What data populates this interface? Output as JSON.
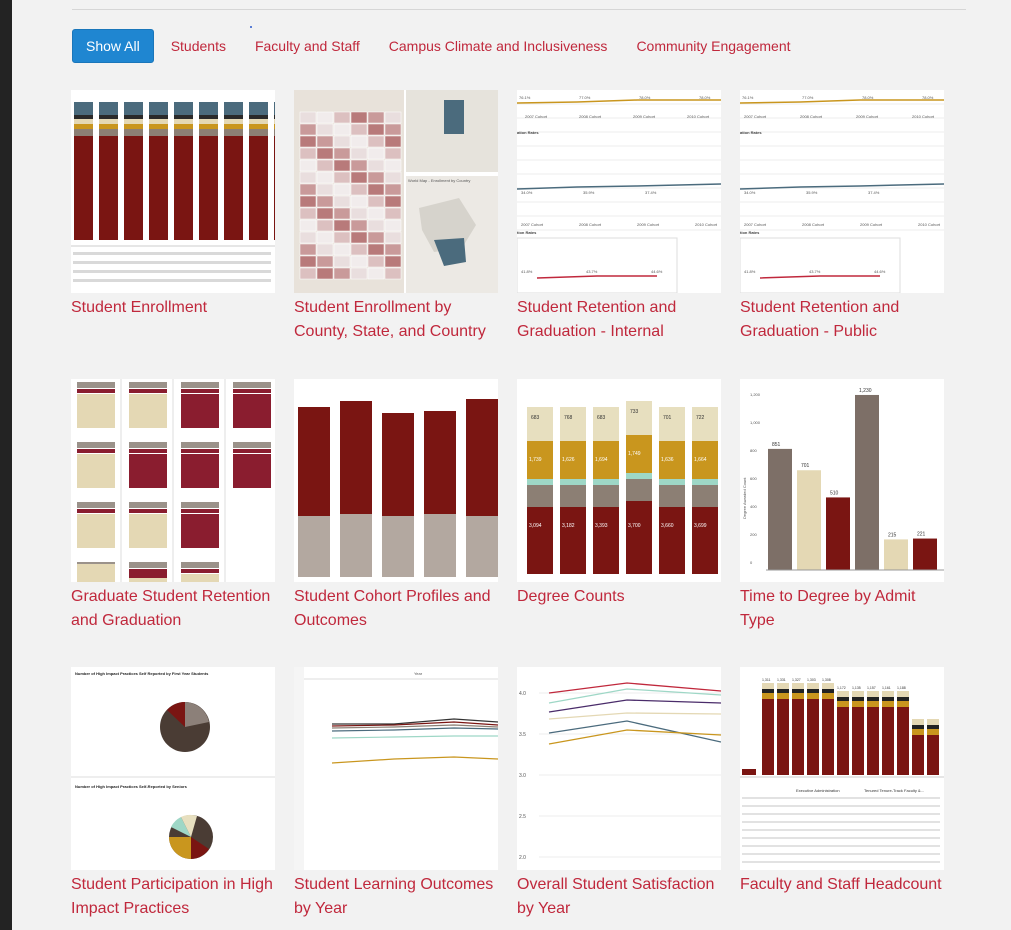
{
  "filters": {
    "show_all": "Show All",
    "students": "Students",
    "faculty_staff": "Faculty and Staff",
    "campus_climate": "Campus Climate and Inclusiveness",
    "community": "Community Engagement"
  },
  "tiles": [
    {
      "title": "Student Enrollment"
    },
    {
      "title": "Student Enrollment by County, State, and Country"
    },
    {
      "title": "Student Retention and Graduation - Internal"
    },
    {
      "title": "Student Retention and Graduation - Public"
    },
    {
      "title": "Graduate Student Retention and Graduation"
    },
    {
      "title": "Student Cohort Profiles and Outcomes"
    },
    {
      "title": "Degree Counts"
    },
    {
      "title": "Time to Degree by Admit Type"
    },
    {
      "title": "Student Participation in High Impact Practices"
    },
    {
      "title": "Student Learning Outcomes by Year"
    },
    {
      "title": "Overall Student Satisfaction by Year"
    },
    {
      "title": "Faculty and Staff Headcount"
    }
  ],
  "thumb_text": {
    "map_label": "World Map - Enrollment by Country",
    "ret_labels": [
      "76.1%",
      "77.0%",
      "78.0%",
      "78.0%"
    ],
    "ret_mid": [
      "34.0%",
      "35.9%",
      "37.4%"
    ],
    "ret_low": [
      "41.8%",
      "43.7%",
      "44.6%"
    ],
    "cohorts": [
      "2007 Cohort",
      "2008 Cohort",
      "2009 Cohort",
      "2010 Cohort"
    ],
    "ret_heads": [
      "ation Rates",
      "tion Rates"
    ],
    "degree_top": [
      "683",
      "768",
      "683",
      "733",
      "701",
      "722"
    ],
    "degree_mid": [
      "1,739",
      "1,626",
      "1,694",
      "1,749",
      "1,636",
      "1,664"
    ],
    "degree_bot": [
      "3,094",
      "3,182",
      "3,393",
      "3,700",
      "3,660",
      "3,699"
    ],
    "ttd_values": [
      "851",
      "701",
      "510",
      "1,230",
      "215",
      "221"
    ],
    "ttd_axis": [
      "1,200",
      "1,000",
      "800",
      "600",
      "400",
      "200",
      "0"
    ],
    "ttd_ylabel": "Degree Awarded Count",
    "hip_title1": "Number of High Impact Practices Self Reported by First Year Students",
    "hip_title2": "Number of High Impact Practices Self-Reported by Seniors",
    "slo_head": "Year",
    "sat_axis": [
      "4.0",
      "3.5",
      "3.0",
      "2.5",
      "2.0"
    ],
    "fs_tops": [
      "1,311",
      "1,331",
      "1,327",
      "1,303",
      "1,308",
      "1,172",
      "1,135",
      "1,157",
      "1,161",
      "1,188"
    ],
    "fs_row1": "Executive Administration",
    "fs_row2": "Tenured Tenure-Track Faculty &..."
  },
  "colors": {
    "accent": "#c0283c",
    "button": "#1f86d1",
    "maroon": "#7a1512",
    "gold": "#c9961e",
    "beige": "#e4d8b4",
    "slate": "#4b6b7d",
    "taupe": "#8c7f74",
    "wine": "#8a1d2f"
  }
}
